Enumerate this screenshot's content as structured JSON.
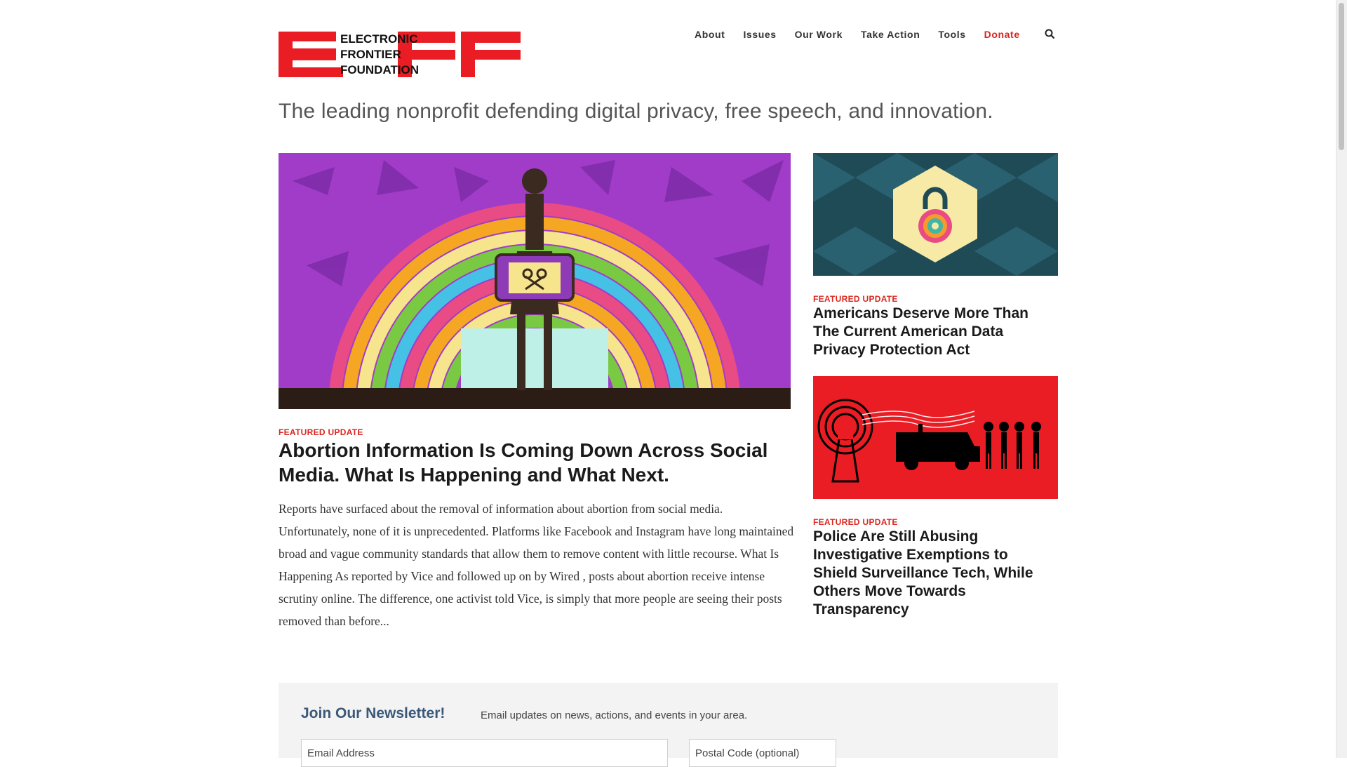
{
  "header": {
    "logo_text": [
      "ELECTRONIC",
      "FRONTIER",
      "FOUNDATION"
    ],
    "nav": [
      {
        "label": "About"
      },
      {
        "label": "Issues"
      },
      {
        "label": "Our Work"
      },
      {
        "label": "Take Action"
      },
      {
        "label": "Tools"
      },
      {
        "label": "Donate"
      }
    ],
    "search_icon": "search-icon"
  },
  "tagline": "The leading nonprofit defending digital privacy, free speech, and innovation.",
  "feature": {
    "kicker": "FEATURED UPDATE",
    "title": "Abortion Information Is Coming Down Across Social Media. What Is Happening and What Next.",
    "excerpt": "Reports have surfaced about the removal of information about abortion from social media. Unfortunately, none of it is unprecedented. Platforms like Facebook and Instagram have long maintained broad and vague community standards that allow them to remove content with little recourse. What Is Happening As reported by Vice and followed up on by Wired , posts about abortion receive intense scrutiny online. The difference, one activist told Vice, is simply that more people are seeing their posts removed than before..."
  },
  "side": [
    {
      "kicker": "FEATURED UPDATE",
      "title": "Americans Deserve More Than The Current American Data Privacy Protection Act"
    },
    {
      "kicker": "FEATURED UPDATE",
      "title": "Police Are Still Abusing Investigative Exemptions to Shield Surveillance Tech, While Others Move Towards Transparency"
    }
  ],
  "newsletter": {
    "title": "Join Our Newsletter!",
    "description": "Email updates on news, actions, and events in your area.",
    "email_placeholder": "Email Address",
    "postal_placeholder": "Postal Code (optional)"
  },
  "colors": {
    "accent": "#d9261f",
    "newsletter_title": "#3b5878",
    "newsletter_bg": "#f3f3f3"
  }
}
